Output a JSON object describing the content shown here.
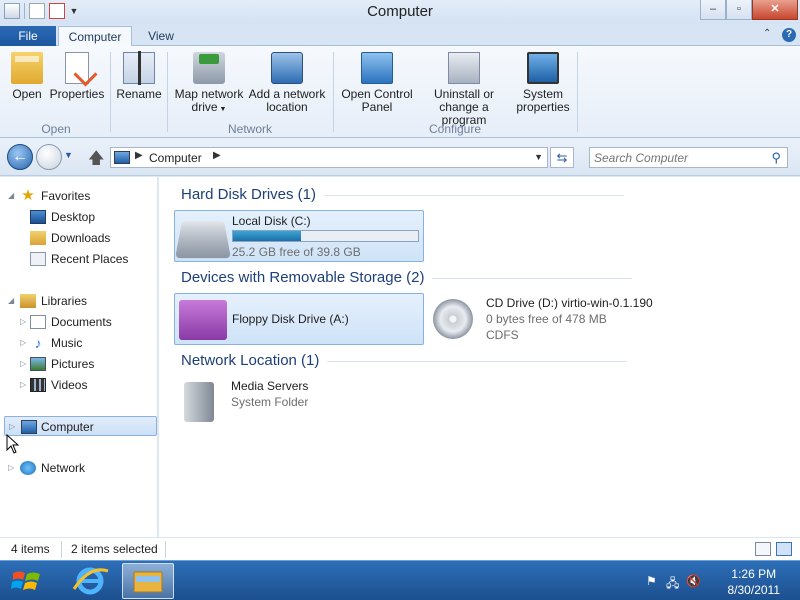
{
  "window": {
    "title": "Computer"
  },
  "ribbon_tabs": {
    "file": "File",
    "computer": "Computer",
    "view": "View"
  },
  "ribbon": {
    "open": "Open",
    "properties": "Properties",
    "rename": "Rename",
    "map_network_drive": "Map network",
    "map_network_drive_2": "drive",
    "add_network_location": "Add a network",
    "add_network_location_2": "location",
    "open_control_panel": "Open Control",
    "open_control_panel_2": "Panel",
    "uninstall": "Uninstall or",
    "uninstall_2": "change a program",
    "system_properties": "System",
    "system_properties_2": "properties",
    "group_open": "Open",
    "group_network": "Network",
    "group_configure": "Configure"
  },
  "address": {
    "crumb": "Computer",
    "search_placeholder": "Search Computer"
  },
  "nav": {
    "favorites": "Favorites",
    "desktop": "Desktop",
    "downloads": "Downloads",
    "recent_places": "Recent Places",
    "libraries": "Libraries",
    "documents": "Documents",
    "music": "Music",
    "pictures": "Pictures",
    "videos": "Videos",
    "computer": "Computer",
    "network": "Network"
  },
  "content": {
    "groups": {
      "hdd": "Hard Disk Drives (1)",
      "removable": "Devices with Removable Storage (2)",
      "network": "Network Location (1)"
    },
    "local_disk": {
      "name": "Local Disk (C:)",
      "free": "25.2 GB free of 39.8 GB",
      "used_fraction": 0.367
    },
    "floppy": {
      "name": "Floppy Disk Drive (A:)"
    },
    "cd": {
      "name": "CD Drive (D:) virtio-win-0.1.190",
      "free": "0 bytes free of 478 MB",
      "fs": "CDFS"
    },
    "media": {
      "name": "Media Servers",
      "type": "System Folder"
    }
  },
  "status": {
    "items": "4 items",
    "selected": "2 items selected"
  },
  "taskbar": {
    "time": "1:26 PM",
    "date": "8/30/2011"
  },
  "colors": {
    "taskbar": "#1c4f8e",
    "accent": "#1d57a0",
    "group_header": "#1e3f79"
  }
}
